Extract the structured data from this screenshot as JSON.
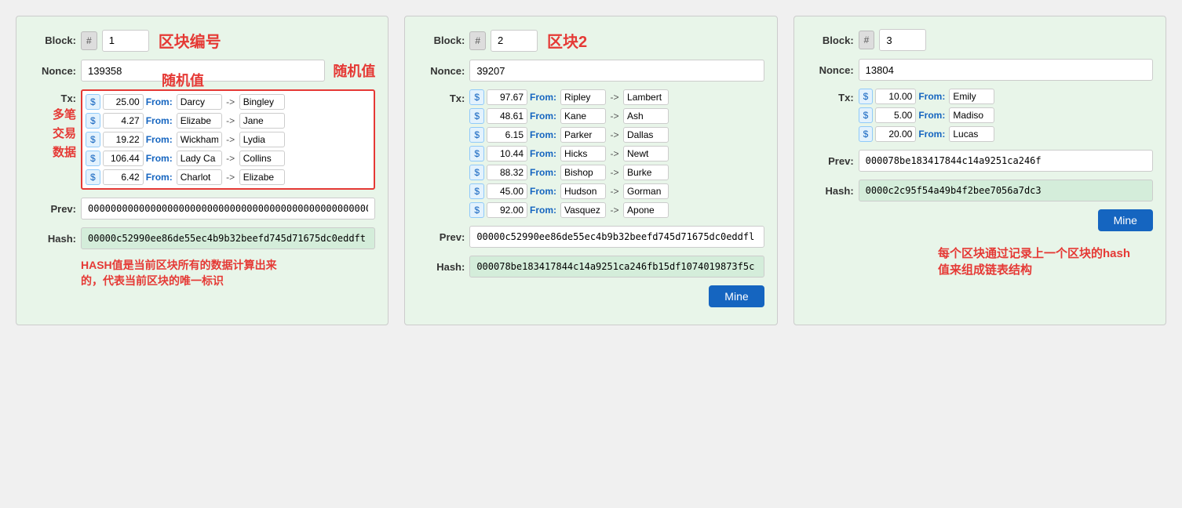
{
  "blocks": [
    {
      "id": "block1",
      "block_label": "Block:",
      "block_hash_symbol": "#",
      "block_number": "1",
      "block_title": "区块编号",
      "nonce_label": "Nonce:",
      "nonce_value": "139358",
      "nonce_annotation": "随机值",
      "tx_label": "Tx:",
      "tx_annotation_line1": "多笔",
      "tx_annotation_line2": "交易",
      "tx_annotation_line3": "数据",
      "transactions": [
        {
          "amount": "25.00",
          "from": "Darcy",
          "to": "Bingley"
        },
        {
          "amount": "4.27",
          "from": "Elizabe",
          "to": "Jane"
        },
        {
          "amount": "19.22",
          "from": "Wickham",
          "to": "Lydia"
        },
        {
          "amount": "106.44",
          "from": "Lady Ca",
          "to": "Collins"
        },
        {
          "amount": "6.42",
          "from": "Charlot",
          "to": "Elizabe"
        }
      ],
      "prev_label": "Prev:",
      "prev_value": "00000000000000000000000000000000000000000000000000000000000000000000000000000",
      "hash_label": "Hash:",
      "hash_value": "00000c52990ee86de55ec4b9b32beefd745d71675dc0eddft",
      "hash_annotation_line1": "HASH值是当前区块所有的数据计算出来",
      "hash_annotation_line2": "的，代表当前区块的唯一标识",
      "has_mine": false
    },
    {
      "id": "block2",
      "block_label": "Block:",
      "block_hash_symbol": "#",
      "block_number": "2",
      "block_title": "区块2",
      "nonce_label": "Nonce:",
      "nonce_value": "39207",
      "tx_label": "Tx:",
      "transactions": [
        {
          "amount": "97.67",
          "from": "Ripley",
          "to": "Lambert"
        },
        {
          "amount": "48.61",
          "from": "Kane",
          "to": "Ash"
        },
        {
          "amount": "6.15",
          "from": "Parker",
          "to": "Dallas"
        },
        {
          "amount": "10.44",
          "from": "Hicks",
          "to": "Newt"
        },
        {
          "amount": "88.32",
          "from": "Bishop",
          "to": "Burke"
        },
        {
          "amount": "45.00",
          "from": "Hudson",
          "to": "Gorman"
        },
        {
          "amount": "92.00",
          "from": "Vasquez",
          "to": "Apone"
        }
      ],
      "prev_label": "Prev:",
      "prev_value": "00000c52990ee86de55ec4b9b32beefd745d71675dc0eddfl",
      "hash_label": "Hash:",
      "hash_value": "000078be183417844c14a9251ca246fb15df1074019873f5c",
      "has_mine": true,
      "mine_label": "Mine"
    },
    {
      "id": "block3",
      "block_label": "Block:",
      "block_hash_symbol": "#",
      "block_number": "3",
      "nonce_label": "Nonce:",
      "nonce_value": "13804",
      "tx_label": "Tx:",
      "transactions": [
        {
          "amount": "10.00",
          "from": "Emily",
          "to": ""
        },
        {
          "amount": "5.00",
          "from": "Madiso",
          "to": ""
        },
        {
          "amount": "20.00",
          "from": "Lucas",
          "to": ""
        }
      ],
      "prev_label": "Prev:",
      "prev_value": "000078be183417844c14a9251ca246f",
      "hash_label": "Hash:",
      "hash_value": "0000c2c95f54a49b4f2bee7056a7dc3",
      "has_mine": true,
      "mine_label": "Mine",
      "chain_annotation_line1": "每个区块通过记录上一个区块的hash",
      "chain_annotation_line2": "值来组成链表结构"
    }
  ],
  "from_label": "From:",
  "arrow_label": "->"
}
